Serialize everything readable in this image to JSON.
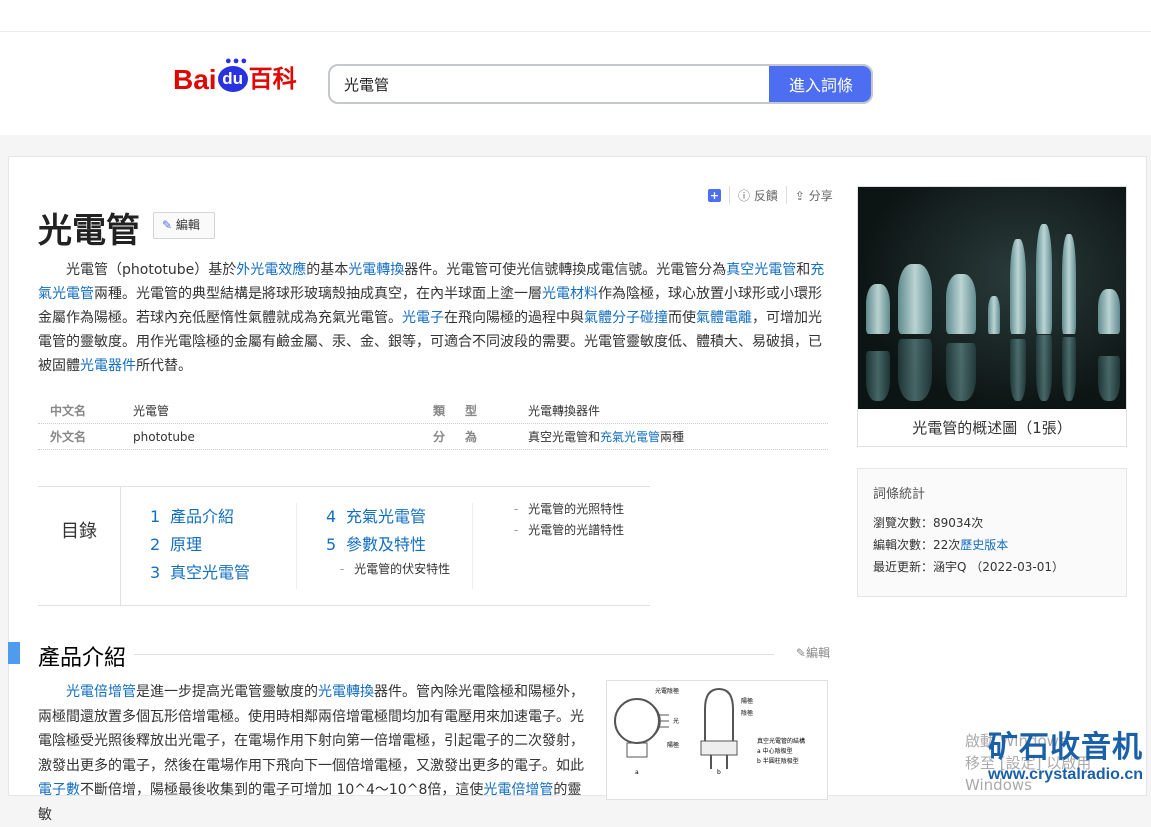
{
  "header": {
    "logo_text": [
      "Bai",
      "du",
      "百科"
    ],
    "search_value": "光電管",
    "search_button": "進入詞條"
  },
  "article": {
    "title": "光電管",
    "edit_label": "編輯",
    "actions": {
      "feedback": "反饋",
      "share": "分享"
    },
    "intro": [
      {
        "t": "光電管（phototube）基於"
      },
      {
        "t": "外光電效應",
        "link": true
      },
      {
        "t": "的基本"
      },
      {
        "t": "光電轉換",
        "link": true
      },
      {
        "t": "器件。光電管可使光信號轉換成電信號。光電管分為"
      },
      {
        "t": "真空光電管",
        "link": true
      },
      {
        "t": "和"
      },
      {
        "t": "充氣光電管",
        "link": true
      },
      {
        "t": "兩種。光電管的典型結構是將球形玻璃殼抽成真空，在內半球面上塗一層"
      },
      {
        "t": "光電材料",
        "link": true
      },
      {
        "t": "作為陰極，球心放置小球形或小環形金屬作為陽極。若球內充低壓惰性氣體就成為充氣光電管。"
      },
      {
        "t": "光電子",
        "link": true
      },
      {
        "t": "在飛向陽極的過程中與"
      },
      {
        "t": "氣體分子碰撞",
        "link": true
      },
      {
        "t": "而使"
      },
      {
        "t": "氣體電離",
        "link": true
      },
      {
        "t": "，可增加光電管的靈敏度。用作光電陰極的金屬有鹼金屬、汞、金、銀等，可適合不同波段的需要。光電管靈敏度低、體積大、易破損，已被固體"
      },
      {
        "t": "光電器件",
        "link": true
      },
      {
        "t": "所代替。"
      }
    ],
    "infobox": [
      {
        "k1": "中文名",
        "v1": "光電管",
        "k2": "類　型",
        "v2": [
          {
            "t": "光電轉換器件"
          }
        ]
      },
      {
        "k1": "外文名",
        "v1": "phototube",
        "k2": "分　為",
        "v2": [
          {
            "t": "真空光電管和"
          },
          {
            "t": "充氣光電管",
            "link": true
          },
          {
            "t": "兩種"
          }
        ]
      }
    ],
    "toc": {
      "label": "目錄",
      "col1": [
        {
          "n": "1",
          "t": "產品介紹"
        },
        {
          "n": "2",
          "t": "原理"
        },
        {
          "n": "3",
          "t": "真空光電管"
        }
      ],
      "col2": [
        {
          "n": "4",
          "t": "充氣光電管"
        },
        {
          "n": "5",
          "t": "參數及特性"
        }
      ],
      "col2_sub": [
        "光電管的伏安特性"
      ],
      "col3_sub": [
        "光電管的光照特性",
        "光電管的光譜特性"
      ]
    },
    "section": {
      "title": "產品介紹",
      "edit_label": "編輯",
      "body": [
        {
          "t": "光電倍增管",
          "link": true
        },
        {
          "t": "是進一步提高光電管靈敏度的"
        },
        {
          "t": "光電轉換",
          "link": true
        },
        {
          "t": "器件。管內除光電陰極和陽極外，兩極間還放置多個瓦形倍增電極。使用時相鄰兩倍增電極間均加有電壓用來加速電子。光電陰極受光照後釋放出光電子，在電場作用下射向第一倍增電極，引起電子的二次發射，激發出更多的電子，然後在電場作用下飛向下一個倍增電極，又激發出更多的電子。如此"
        },
        {
          "t": "電子數",
          "link": true
        },
        {
          "t": "不斷倍增，陽極最後收集到的電子可增加 10^4～10^8倍，這使"
        },
        {
          "t": "光電倍增管",
          "link": true
        },
        {
          "t": "的靈敏"
        }
      ],
      "figure_labels": [
        "光電陰極",
        "光",
        "陽極",
        "陽極",
        "陰極",
        "真空光電管的結構",
        "a 中心陰极型",
        "b 半圓柱陰极型",
        "a",
        "b"
      ]
    }
  },
  "sidebar": {
    "photo_caption": "光電管的概述圖（1張）",
    "stats": {
      "title": "詞條統計",
      "views_label": "瀏覽次數：",
      "views": "89034次",
      "edits_label": "編輯次數：",
      "edits": "22次",
      "history_link": "歷史版本",
      "updated_label": "最近更新：",
      "updated": "涵宇Q （2022-03-01）"
    }
  },
  "overlay": {
    "windows_line1": "啟動 Windows",
    "windows_line2": "移至 [設定] 以啟用 Windows",
    "watermark_cn": "矿石收音机",
    "watermark_url": "www.crystalradio.cn"
  },
  "colors": {
    "link": "#136ec2",
    "accent": "#4e6ef2",
    "section_bar": "#4f9cee",
    "baidu_red": "#e10601",
    "baidu_blue": "#2932e1"
  }
}
